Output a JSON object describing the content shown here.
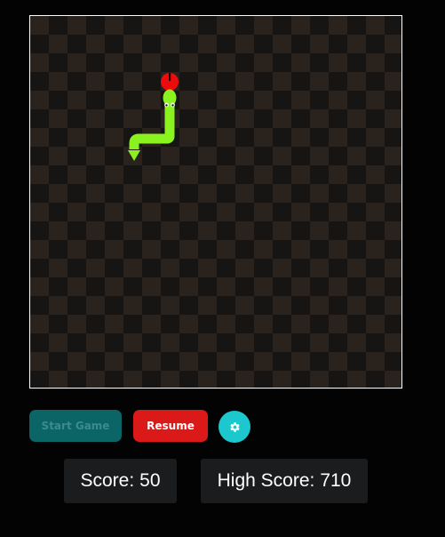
{
  "controls": {
    "start_label": "Start Game",
    "resume_label": "Resume",
    "settings_icon": "gear-icon"
  },
  "scoreboard": {
    "score_label": "Score:",
    "score_value": "50",
    "high_score_label": "High Score:",
    "high_score_value": "710"
  },
  "colors": {
    "board_light": "#2a221c",
    "board_dark": "#161513",
    "snake": "#8af21e",
    "apple": "#ee0b0b",
    "start_button": "#0b6466",
    "resume_button": "#dc1919",
    "settings_button": "#1cc8cd",
    "score_box": "#1b1c1e"
  }
}
